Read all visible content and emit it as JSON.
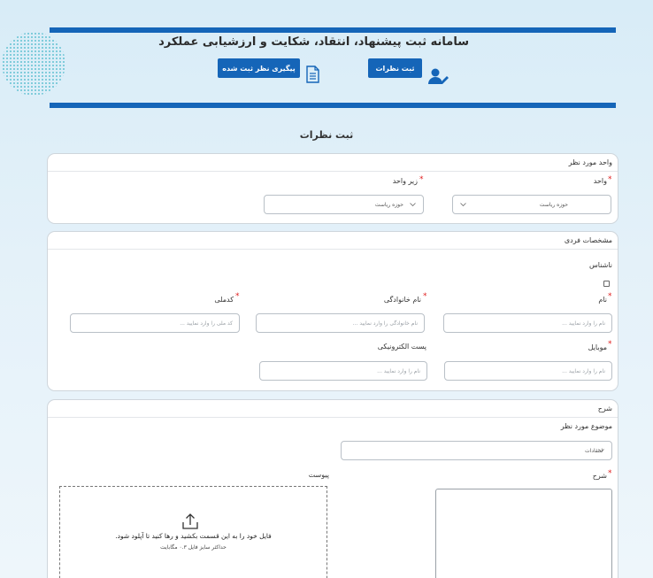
{
  "header": {
    "title": "سامانه ثبت پیشنهاد، انتقاد، شکایت و ارزشیابی عملکرد",
    "track_button": "پیگیری نظر ثبت شده",
    "submit_button": "ثبت نظرات",
    "doc_icon": "document-icon",
    "user_icon": "user-edit-icon"
  },
  "page": {
    "title": "ثبت نظرات"
  },
  "unit_section": {
    "heading": "واحد مورد نظر",
    "unit_label": "واحد",
    "unit_value": "حوزه ریاست",
    "subunit_label": "زیر واحد",
    "subunit_value": "حوزه ریاست"
  },
  "personal_section": {
    "heading": "مشخصات فردی",
    "anonymous_label": "ناشناس",
    "first_name_label": "نام",
    "first_name_placeholder": "نام را وارد نمایید ...",
    "last_name_label": "نام خانوادگی",
    "last_name_placeholder": "نام خانوادگی را وارد نمایید ...",
    "national_code_label": "کدملی",
    "national_code_placeholder": "کد ملی را وارد نمایید ...",
    "mobile_label": "موبایل",
    "mobile_placeholder": "نام را وارد نمایید ...",
    "email_label": "پست الکترونیکی",
    "email_placeholder": "نام را وارد نمایید ..."
  },
  "description_section": {
    "heading": "شرح",
    "topic_label": "موضوع مورد نظر",
    "topic_value": "انتقادات",
    "description_label": "شرح",
    "attachment_label": "پیوست",
    "dropzone_text": "فایل خود را به این قسمت بکشید و رها کنید تا آپلود شود.",
    "dropzone_hint": "حداکثر سایز فایل ۰.۳ مگابایت"
  },
  "colors": {
    "primary": "#1565b8",
    "required": "#e02020",
    "background": "#dcedf8"
  }
}
